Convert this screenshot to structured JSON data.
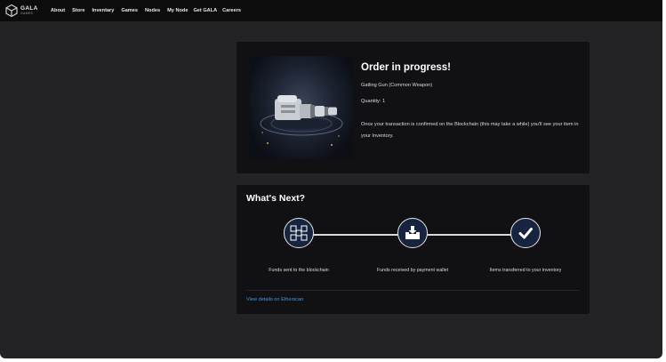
{
  "nav": {
    "logo_line1": "GALA",
    "logo_line2": "GAMES",
    "items": [
      "About",
      "Store",
      "Inventary",
      "Games",
      "Nodes",
      "My Node",
      "Get GALA",
      "Careers"
    ]
  },
  "order": {
    "title": "Order in progress!",
    "item_name": "Gatling Gun (Common Weapon)",
    "quantity": "Quantity: 1",
    "message": "Once your transaction is confirmed on the Blockchain (this may take a while) you'll see your item in your Inventory."
  },
  "whats_next": {
    "title": "What's Next?",
    "steps": [
      {
        "label": "Funds sent to the blockchain",
        "icon": "blockchain-icon"
      },
      {
        "label": "Funds received by payment wallet",
        "icon": "download-tray-icon"
      },
      {
        "label": "Items transferred to your inventory",
        "icon": "checkmark-icon"
      }
    ],
    "link": "View details on Etherscan"
  },
  "colors": {
    "background": "#232325",
    "navbar": "#0c0c0d",
    "card": "#111113",
    "step_circle": "#16243f",
    "link": "#3d9be9"
  }
}
